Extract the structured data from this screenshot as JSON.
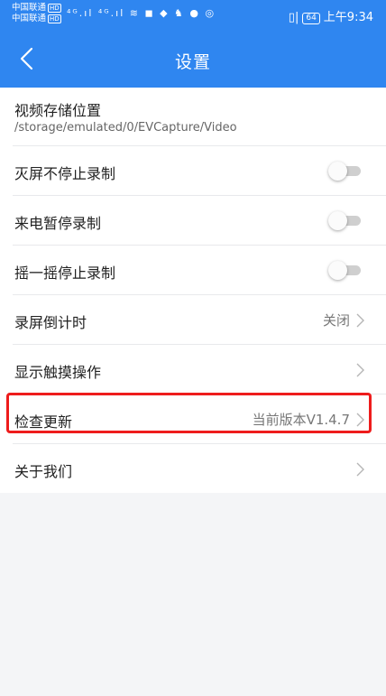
{
  "status_bar": {
    "carrier_1": "中国联通",
    "carrier_1_badge": "HD",
    "carrier_2": "中国联通",
    "carrier_2_badge": "HD",
    "signal_icons": "⁴ᴳ.ıl ⁴ᴳ.ıl ≋ ◼ ◆ ♞ ● ◎",
    "vibrate_icon": "▯|",
    "battery": "64",
    "time": "上午9:34"
  },
  "nav": {
    "title": "设置"
  },
  "settings": {
    "storage": {
      "label": "视频存储位置",
      "path": "/storage/emulated/0/EVCapture/Video"
    },
    "screen_off": {
      "label": "灭屏不停止录制",
      "enabled": false
    },
    "incoming_call": {
      "label": "来电暂停录制",
      "enabled": false
    },
    "shake": {
      "label": "摇一摇停止录制",
      "enabled": false
    },
    "countdown": {
      "label": "录屏倒计时",
      "value": "关闭"
    },
    "show_touch": {
      "label": "显示触摸操作"
    },
    "check_update": {
      "label": "检查更新",
      "value": "当前版本V1.4.7"
    },
    "about": {
      "label": "关于我们"
    }
  },
  "colors": {
    "header": "#2f86f0",
    "highlight": "#ee1c1c",
    "toggle_off_track": "#cfcfcf"
  }
}
